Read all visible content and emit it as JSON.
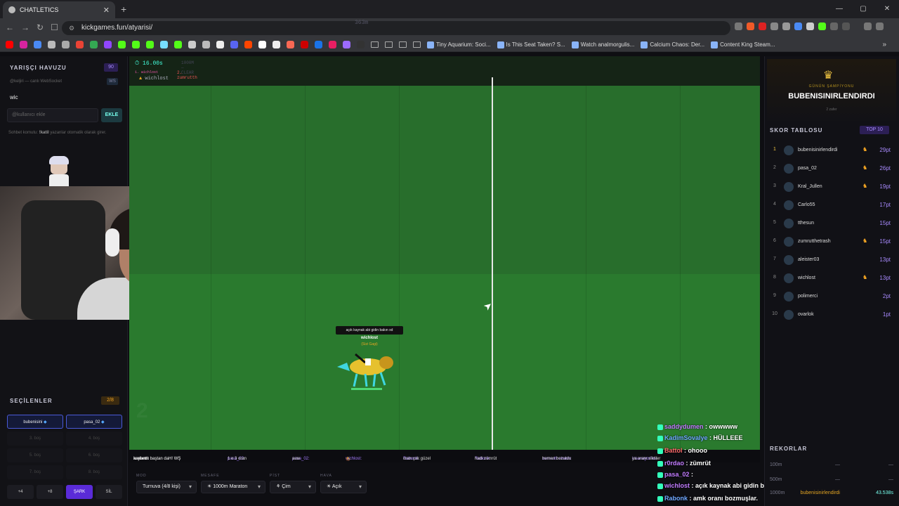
{
  "browser": {
    "tab_title": "CHATLETICS",
    "url": "kickgames.fun/atyarisi/",
    "bookmarks": [
      "Tiny Aquarium: Soci...",
      "Is This Seat Taken? S...",
      "Watch analmorgulis...",
      "Calcium Chaos: Der...",
      "Content King Steam..."
    ]
  },
  "left_panel": {
    "title": "YARIŞÇI HAVUZU",
    "count": "90",
    "subtitle": "@keljiri — canlı WebSocket",
    "ws": "WS",
    "user": "wic",
    "input_placeholder": "@kullanıcı ekle",
    "add_label": "EKLE",
    "note_pre": "Sohbet komutu: ",
    "note_cmd": "!katil",
    "note_post": " yazanlar otomatik olarak girer.",
    "selected_title": "SEÇİLENLER",
    "selected_count": "2/8",
    "selected": [
      "bubenisini",
      "pasa_02"
    ],
    "empty_slots": [
      "3. boş",
      "4. boş",
      "5. boş",
      "6. boş",
      "7. boş",
      "8. boş"
    ],
    "actions": [
      "+4",
      "+8",
      "ŞARK",
      "SİL"
    ]
  },
  "track": {
    "time": "16.00s",
    "info": "1000M — CLEAR",
    "place1": "1. wichlost",
    "place2": "2. zumrutth",
    "leader": "wichlost",
    "distance": "363m",
    "horse_bubble": "açık kaynak abi gidin bakın xd",
    "horse_name": "wichlost",
    "horse_sub": "(Sizi Gagi)",
    "ghost": "2"
  },
  "ticker": [
    {
      "u": "kaybetti:",
      "m": "aralarım baştan daH! WŞ"
    },
    {
      "u": "pasa_02:",
      "m": "1 e 3 oran"
    },
    {
      "u": "pasa_02:",
      "m": "auw"
    },
    {
      "u": "wichlost:",
      "m": "🏇"
    },
    {
      "u": "Rabonk:",
      "m": "oran çok güzel"
    },
    {
      "u": "Rabonk:",
      "m": "hadi zümrüt"
    },
    {
      "u": "zumrutthetrash:",
      "m": "hemen bozuldu"
    },
    {
      "u": "insanayorfas:",
      "m": "ya oranı siktiler"
    }
  ],
  "controls": [
    {
      "label": "MOD",
      "value": "Turnuva (4/8 kişi)"
    },
    {
      "label": "MESAFE",
      "value": "☀ 1000m Maraton"
    },
    {
      "label": "PİST",
      "value": "⚘ Çim"
    },
    {
      "label": "HAVA",
      "value": "☀ Açık"
    }
  ],
  "chat": [
    {
      "user": "saddydumen",
      "msg": " : owwwww"
    },
    {
      "user": "KadimSovalye",
      "msg": " : HÜLLEEE"
    },
    {
      "user": "Battol",
      "msg": " : ohooo"
    },
    {
      "user": "r0rdao",
      "msg": " : zümrüt"
    },
    {
      "user": "pasa_02",
      "msg": " :"
    },
    {
      "user": "wichlost",
      "msg": " : açık kaynak abi gidin bakın"
    },
    {
      "user": "Rabonk",
      "msg": " : amk oranı bozmuşlar."
    }
  ],
  "right_panel": {
    "champ_label": "GÜNÜN ŞAMPİYONU",
    "champ_name": "BUBENISINIRLENDIRDI",
    "champ_wins": "2 zafer",
    "score_title": "SKOR TABLOSU",
    "score_badge": "TOP 10",
    "scores": [
      {
        "rank": "1",
        "name": "bubenisinirlendirdi",
        "pts": "29pt",
        "hr": true
      },
      {
        "rank": "2",
        "name": "pasa_02",
        "pts": "26pt",
        "hr": true
      },
      {
        "rank": "3",
        "name": "Kral_Jullen",
        "pts": "19pt",
        "hr": true
      },
      {
        "rank": "4",
        "name": "Carlo55",
        "pts": "17pt",
        "hr": false
      },
      {
        "rank": "5",
        "name": "tthesun",
        "pts": "15pt",
        "hr": false
      },
      {
        "rank": "6",
        "name": "zumrutthetrash",
        "pts": "15pt",
        "hr": true
      },
      {
        "rank": "7",
        "name": "aleister03",
        "pts": "13pt",
        "hr": false
      },
      {
        "rank": "8",
        "name": "wichlost",
        "pts": "13pt",
        "hr": true
      },
      {
        "rank": "9",
        "name": "polimerci",
        "pts": "2pt",
        "hr": false
      },
      {
        "rank": "10",
        "name": "ovarlok",
        "pts": "1pt",
        "hr": false
      }
    ],
    "records_title": "REKORLAR",
    "records": [
      {
        "dist": "100m",
        "name": "—",
        "time": "—"
      },
      {
        "dist": "500m",
        "name": "—",
        "time": "—"
      },
      {
        "dist": "1000m",
        "name": "bubenisinirlendirdi",
        "time": "43.538s"
      }
    ]
  }
}
